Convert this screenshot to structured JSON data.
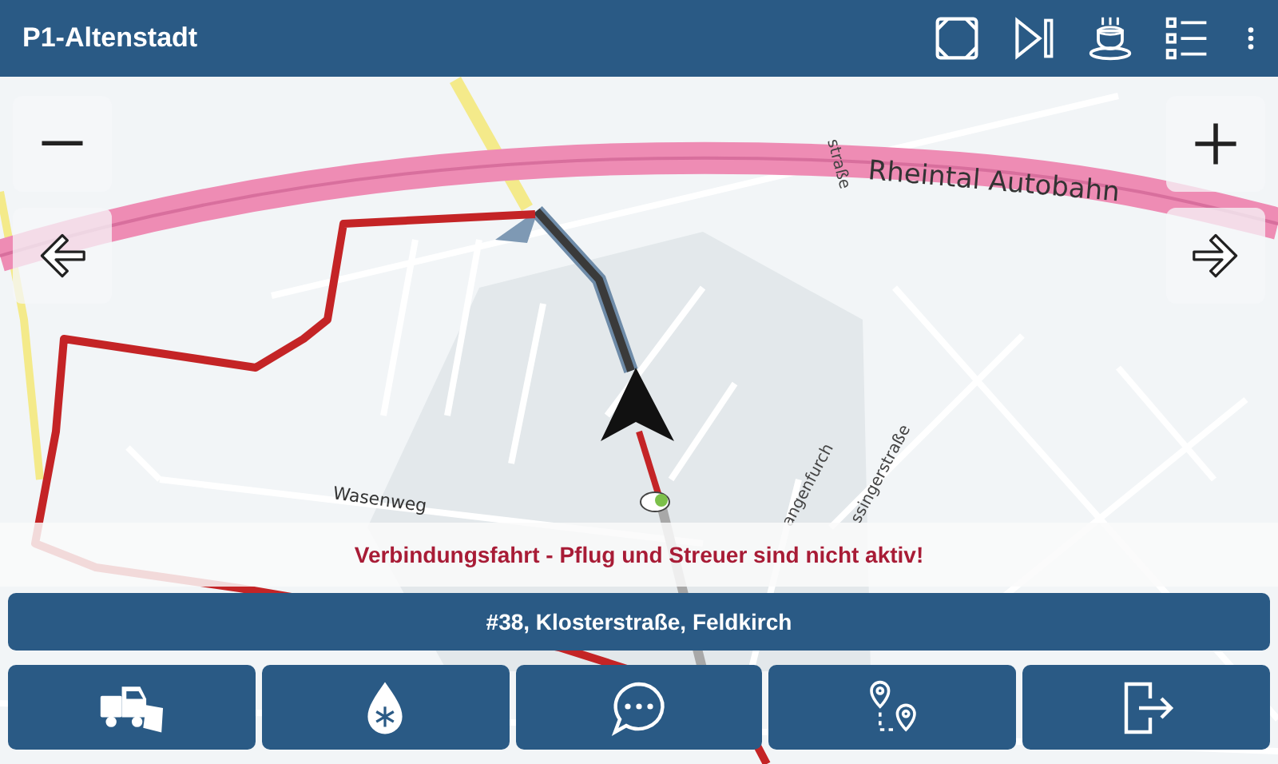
{
  "header": {
    "title": "P1-Altenstadt"
  },
  "map": {
    "labels": [
      {
        "text": "Rheintal Autobahn"
      },
      {
        "text": "Wasenweg"
      },
      {
        "text": "straße"
      },
      {
        "text": "angenfurch"
      },
      {
        "text": "ssingerstraße"
      }
    ]
  },
  "status_message": "Verbindungsfahrt - Pflug und Streuer sind nicht aktiv!",
  "address": "#38, Klosterstraße, Feldkirch"
}
